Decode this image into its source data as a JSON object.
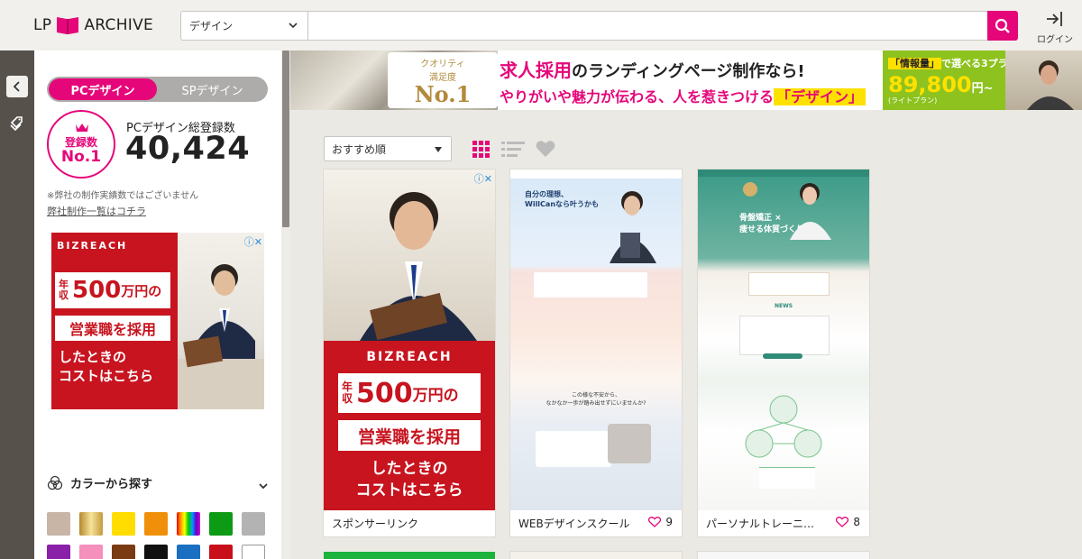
{
  "header": {
    "logo_left": "LP",
    "logo_right": "ARCHIVE",
    "category_value": "デザイン",
    "search_value": "",
    "login_label": "ログイン"
  },
  "sidebar": {
    "tab_pc": "PCデザイン",
    "tab_sp": "SPデザイン",
    "badge_line1": "登録数",
    "badge_line2": "No.1",
    "total_label": "PCデザイン総登録数",
    "total_count": "40,424",
    "note": "※弊社の制作実績数ではございません",
    "works_link": "弊社制作一覧はコチラ",
    "ad": {
      "brand": "BIZREACH",
      "line_small": "年収",
      "line_big": "500",
      "line_unit": "万円の",
      "line2": "営業職を採用",
      "line3": "したときの",
      "line4": "コストはこちら"
    },
    "color_title": "カラーから探す",
    "swatches": [
      "#c8b5a6",
      "gold-gradient",
      "#ffdd00",
      "#f0900a",
      "rainbow",
      "#0d9a14",
      "#b3b3b3",
      "#8a1fa8",
      "#f58fbb",
      "#7a3a12",
      "#111111",
      "#1a6fc1",
      "#c8101a",
      "#ffffff"
    ]
  },
  "banner": {
    "badge_top": "クオリティ",
    "badge_mid": "満足度",
    "badge_no1": "No.1",
    "line1_a": "求人採用",
    "line1_b": "のランディングページ制作なら!",
    "line2_a": "やりがいや魅力が伝わる、人を惹きつける",
    "line2_b": "「デザイン」",
    "plan_a": "「情報量」",
    "plan_b": "で選べる3プラン",
    "price": "89,800",
    "price_unit": "円~",
    "price_note": "(ライトプラン)"
  },
  "toolbar": {
    "sort_value": "おすすめ順"
  },
  "cards": [
    {
      "title": "スポンサーリンク",
      "likes": ""
    },
    {
      "title": "WEBデザインスクール",
      "likes": "9"
    },
    {
      "title": "パーソナルトレーニ…",
      "likes": "8"
    }
  ],
  "card_previews": {
    "ad_brand": "BIZREACH",
    "willcan_head1": "自分の理想、",
    "willcan_head2": "WillCanなら叶うかも",
    "willcan_mid": "この様な不安から、",
    "willcan_mid2": "なかなか一歩が踏み出せずにいませんか?",
    "trainer_head1": "骨盤矯正 ×",
    "trainer_head2": "痩せる体質づくり",
    "trainer_sub": "NEWS"
  }
}
